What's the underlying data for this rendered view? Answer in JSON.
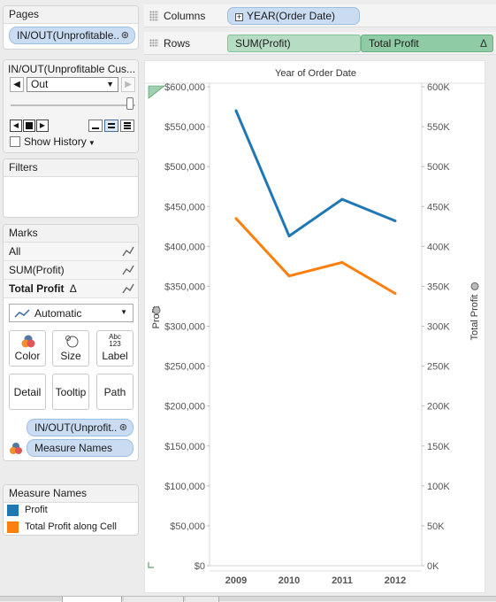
{
  "pages": {
    "header": "Pages",
    "pill": "IN/OUT(Unprofitable.."
  },
  "page_control": {
    "title": "IN/OUT(Unprofitable Cus...",
    "selected_value": "Out",
    "show_history": "Show History"
  },
  "filters": {
    "header": "Filters"
  },
  "marks": {
    "header": "Marks",
    "rows": [
      "All",
      "SUM(Profit)",
      "Total Profit"
    ],
    "delta": "Δ",
    "mark_type": "Automatic",
    "buttons": {
      "color": "Color",
      "size": "Size",
      "label": "Label",
      "label_icon": "Abc\n123",
      "detail": "Detail",
      "tooltip": "Tooltip",
      "path": "Path"
    },
    "pills": [
      "IN/OUT(Unprofit..",
      "Measure Names"
    ]
  },
  "legend": {
    "header": "Measure Names",
    "items": [
      {
        "label": "Profit",
        "color": "#1f77b4"
      },
      {
        "label": "Total Profit along Cell",
        "color": "#ff7f0e"
      }
    ]
  },
  "shelves": {
    "columns_label": "Columns",
    "rows_label": "Rows",
    "columns_pill": "YEAR(Order Date)",
    "rows_pills": [
      "SUM(Profit)",
      "Total Profit"
    ],
    "rows_delta": "Δ"
  },
  "chart_data": {
    "type": "line",
    "title": "Year of Order Date",
    "categories": [
      "2009",
      "2010",
      "2011",
      "2012"
    ],
    "left_axis": {
      "label": "Profit",
      "ticks": [
        "$0",
        "$50,000",
        "$100,000",
        "$150,000",
        "$200,000",
        "$250,000",
        "$300,000",
        "$350,000",
        "$400,000",
        "$450,000",
        "$500,000",
        "$550,000",
        "$600,000"
      ],
      "ylim": [
        0,
        600000
      ]
    },
    "right_axis": {
      "label": "Total Profit",
      "ticks": [
        "0K",
        "50K",
        "100K",
        "150K",
        "200K",
        "250K",
        "300K",
        "350K",
        "400K",
        "450K",
        "500K",
        "550K",
        "600K"
      ],
      "ylim": [
        0,
        600000
      ]
    },
    "series": [
      {
        "name": "Profit",
        "color": "#1f77b4",
        "values": [
          570000,
          413000,
          459000,
          432000
        ]
      },
      {
        "name": "Total Profit along Cell",
        "color": "#ff7f0e",
        "values": [
          435000,
          363000,
          380000,
          341000
        ]
      }
    ]
  }
}
